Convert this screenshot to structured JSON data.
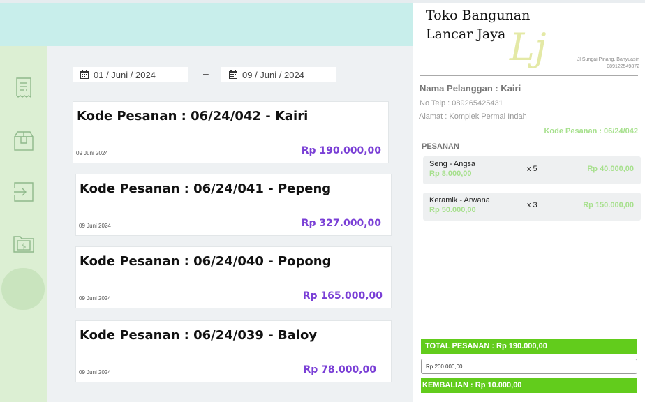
{
  "nav": {
    "items": [
      {
        "icon": "receipt-icon"
      },
      {
        "icon": "package-icon"
      },
      {
        "icon": "import-icon"
      },
      {
        "icon": "money-folder-icon",
        "active": true
      }
    ]
  },
  "filter": {
    "start_date": "01 / Juni / 2024",
    "separator": "–",
    "end_date": "09 / Juni / 2024"
  },
  "orders": [
    {
      "title": "Kode Pesanan : 06/24/042 - Kairi",
      "date": "09 Juni 2024",
      "amount": "Rp 190.000,00"
    },
    {
      "title": "Kode Pesanan : 06/24/041 - Pepeng",
      "date": "09 Juni 2024",
      "amount": "Rp 327.000,00"
    },
    {
      "title": "Kode Pesanan : 06/24/040 - Popong",
      "date": "09 Juni 2024",
      "amount": "Rp 165.000,00"
    },
    {
      "title": "Kode Pesanan : 06/24/039 - Baloy",
      "date": "09 Juni 2024",
      "amount": "Rp 78.000,00"
    }
  ],
  "receipt": {
    "store_line1": "Toko Bangunan",
    "store_line2": "Lancar Jaya",
    "logo_text": "Lj",
    "address": "Jl Sungai Pinang, Banyuasin",
    "phone": "089122549872",
    "customer_name": "Nama Pelanggan : Kairi",
    "customer_phone": "No Telp : 089265425431",
    "customer_address": "Alamat : Komplek Permai Indah",
    "order_code": "Kode Pesanan : 06/24/042",
    "section_title": "PESANAN",
    "items": [
      {
        "name": "Seng - Angsa",
        "price": "Rp 8.000,00",
        "qty": "x 5",
        "subtotal": "Rp 40.000,00"
      },
      {
        "name": "Keramik - Arwana",
        "price": "Rp 50.000,00",
        "qty": "x 3",
        "subtotal": "Rp 150.000,00"
      }
    ],
    "total": "TOTAL PESANAN : Rp 190.000,00",
    "payment_value": "Rp 200.000,00",
    "change": "KEMBALIAN : Rp 10.000,00"
  },
  "colors": {
    "accent_purple": "#7a3fd6",
    "accent_green": "#62cc1c",
    "light_green_text": "#a6e08c",
    "topbar": "#c8eeeb",
    "sidebar": "#dcefd3"
  }
}
